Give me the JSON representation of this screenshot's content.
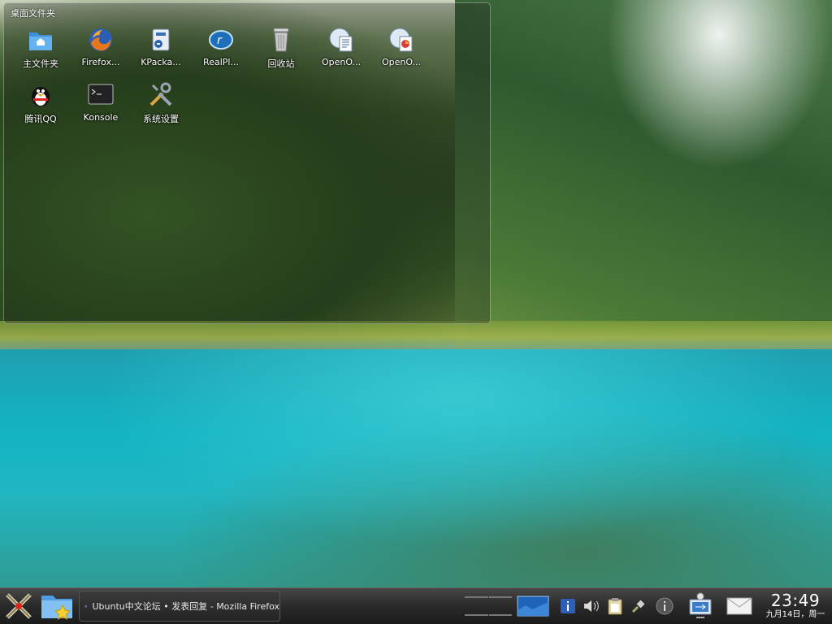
{
  "desktop": {
    "folder_view": {
      "title": "桌面文件夹",
      "icons": [
        {
          "label": "主文件夹",
          "icon": "home-folder-icon"
        },
        {
          "label": "Firefox...",
          "icon": "firefox-icon"
        },
        {
          "label": "KPacka...",
          "icon": "kpackagekit-icon"
        },
        {
          "label": "RealPl...",
          "icon": "realplayer-icon"
        },
        {
          "label": "回收站",
          "icon": "trash-icon"
        },
        {
          "label": "OpenO...",
          "icon": "openoffice-writer-icon"
        },
        {
          "label": "OpenO...",
          "icon": "openoffice-impress-icon"
        },
        {
          "label": "腾讯QQ",
          "icon": "qq-penguin-icon"
        },
        {
          "label": "Konsole",
          "icon": "konsole-terminal-icon"
        },
        {
          "label": "系统设置",
          "icon": "system-settings-icon"
        }
      ]
    }
  },
  "taskbar": {
    "launcher_icon": "kde-launcher-icon",
    "places_icon": "places-folder-star-icon",
    "task": {
      "label": "Ubuntu中文论坛 • 发表回复 - Mozilla Firefox",
      "icon": "firefox-icon"
    },
    "pager": {
      "desktops": 4,
      "active": 0
    },
    "tray_icons": [
      "info-icon",
      "volume-icon",
      "clipboard-icon",
      "device-plug-icon"
    ],
    "clock": {
      "time": "23:49",
      "date": "九月14日，周一"
    }
  },
  "colors": {
    "panel": "#2a2a2a",
    "text": "#ffffff"
  }
}
